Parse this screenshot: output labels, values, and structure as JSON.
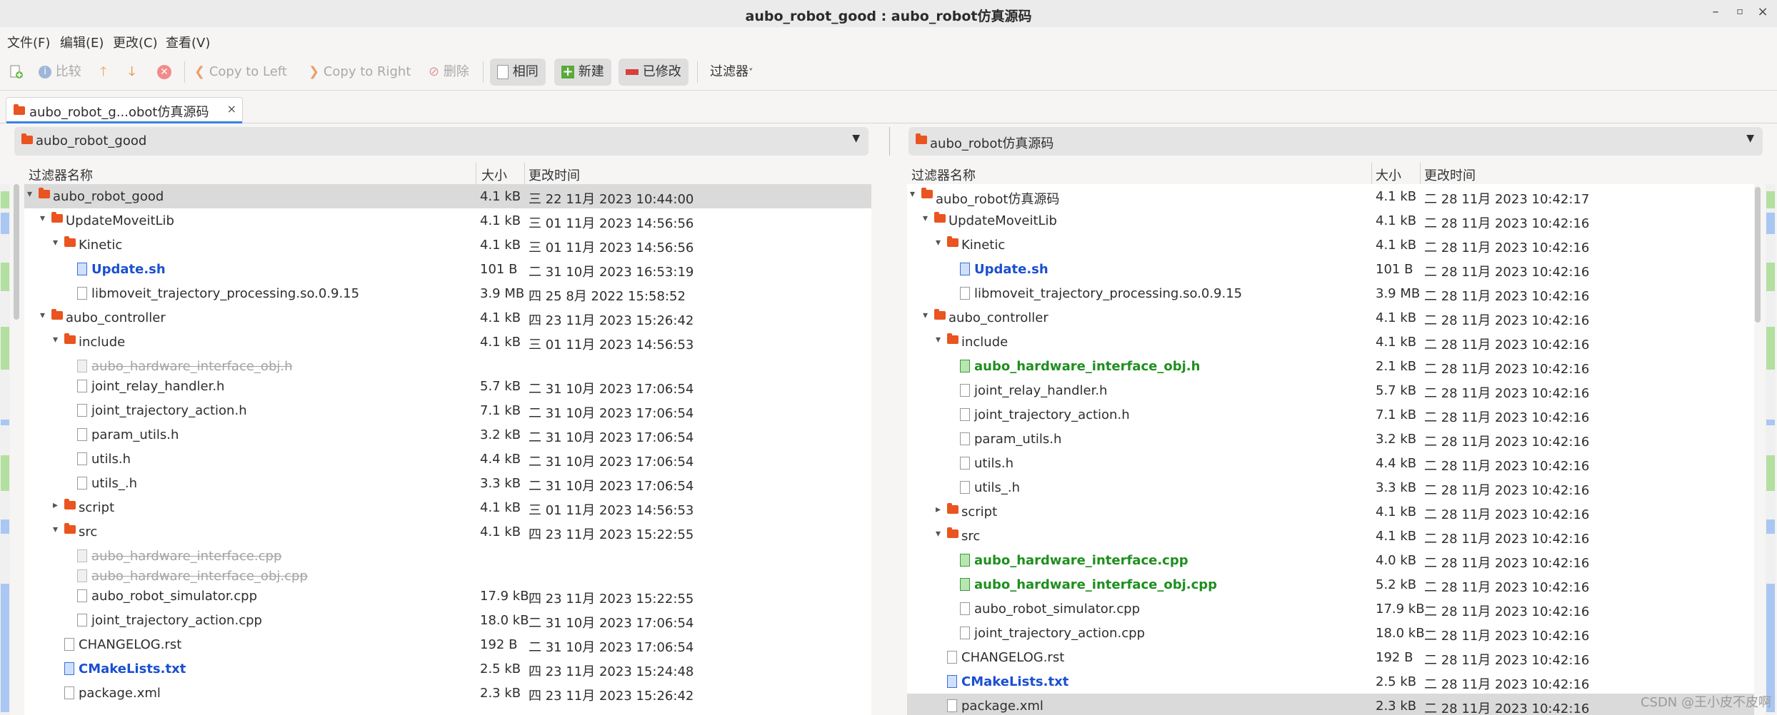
{
  "window": {
    "title": "aubo_robot_good : aubo_robot仿真源码"
  },
  "menu": [
    "文件(F)",
    "编辑(E)",
    "更改(C)",
    "查看(V)"
  ],
  "toolbar": {
    "compare": "比较",
    "copy_left": "Copy to Left",
    "copy_right": "Copy to Right",
    "delete": "删除",
    "same": "相同",
    "new": "新建",
    "modified": "已修改",
    "filter": "过滤器"
  },
  "tab": {
    "label": "aubo_robot_g...obot仿真源码"
  },
  "left": {
    "path": "aubo_robot_good",
    "columns": {
      "name": "过滤器名称",
      "size": "大小",
      "time": "更改时间"
    },
    "rows": [
      {
        "name": "aubo_robot_good",
        "size": "4.1 kB",
        "time": "三 22 11月 2023 10:44:00"
      },
      {
        "name": "UpdateMoveitLib",
        "size": "4.1 kB",
        "time": "三 01 11月 2023 14:56:56"
      },
      {
        "name": "Kinetic",
        "size": "4.1 kB",
        "time": "三 01 11月 2023 14:56:56"
      },
      {
        "name": "Update.sh",
        "size": "101 B",
        "time": "二 31 10月 2023 16:53:19"
      },
      {
        "name": "libmoveit_trajectory_processing.so.0.9.15",
        "size": "3.9 MB",
        "time": "四 25 8月 2022 15:58:52"
      },
      {
        "name": "aubo_controller",
        "size": "4.1 kB",
        "time": "四 23 11月 2023 15:26:42"
      },
      {
        "name": "include",
        "size": "4.1 kB",
        "time": "三 01 11月 2023 14:56:53"
      },
      {
        "name": "aubo_hardware_interface_obj.h",
        "size": "",
        "time": ""
      },
      {
        "name": "joint_relay_handler.h",
        "size": "5.7 kB",
        "time": "二 31 10月 2023 17:06:54"
      },
      {
        "name": "joint_trajectory_action.h",
        "size": "7.1 kB",
        "time": "二 31 10月 2023 17:06:54"
      },
      {
        "name": "param_utils.h",
        "size": "3.2 kB",
        "time": "二 31 10月 2023 17:06:54"
      },
      {
        "name": "utils.h",
        "size": "4.4 kB",
        "time": "二 31 10月 2023 17:06:54"
      },
      {
        "name": "utils_.h",
        "size": "3.3 kB",
        "time": "二 31 10月 2023 17:06:54"
      },
      {
        "name": "script",
        "size": "4.1 kB",
        "time": "三 01 11月 2023 14:56:53"
      },
      {
        "name": "src",
        "size": "4.1 kB",
        "time": "四 23 11月 2023 15:22:55"
      },
      {
        "name": "aubo_hardware_interface.cpp",
        "size": "",
        "time": ""
      },
      {
        "name": "aubo_hardware_interface_obj.cpp",
        "size": "",
        "time": ""
      },
      {
        "name": "aubo_robot_simulator.cpp",
        "size": "17.9 kB",
        "time": "四 23 11月 2023 15:22:55"
      },
      {
        "name": "joint_trajectory_action.cpp",
        "size": "18.0 kB",
        "time": "二 31 10月 2023 17:06:54"
      },
      {
        "name": "CHANGELOG.rst",
        "size": "192 B",
        "time": "二 31 10月 2023 17:06:54"
      },
      {
        "name": "CMakeLists.txt",
        "size": "2.5 kB",
        "time": "四 23 11月 2023 15:24:48"
      },
      {
        "name": "package.xml",
        "size": "2.3 kB",
        "time": "四 23 11月 2023 15:26:42"
      }
    ]
  },
  "right": {
    "path": "aubo_robot仿真源码",
    "columns": {
      "name": "过滤器名称",
      "size": "大小",
      "time": "更改时间"
    },
    "rows": [
      {
        "name": "aubo_robot仿真源码",
        "size": "4.1 kB",
        "time": "二 28 11月 2023 10:42:17"
      },
      {
        "name": "UpdateMoveitLib",
        "size": "4.1 kB",
        "time": "二 28 11月 2023 10:42:16"
      },
      {
        "name": "Kinetic",
        "size": "4.1 kB",
        "time": "二 28 11月 2023 10:42:16"
      },
      {
        "name": "Update.sh",
        "size": "101 B",
        "time": "二 28 11月 2023 10:42:16"
      },
      {
        "name": "libmoveit_trajectory_processing.so.0.9.15",
        "size": "3.9 MB",
        "time": "二 28 11月 2023 10:42:16"
      },
      {
        "name": "aubo_controller",
        "size": "4.1 kB",
        "time": "二 28 11月 2023 10:42:16"
      },
      {
        "name": "include",
        "size": "4.1 kB",
        "time": "二 28 11月 2023 10:42:16"
      },
      {
        "name": "aubo_hardware_interface_obj.h",
        "size": "2.1 kB",
        "time": "二 28 11月 2023 10:42:16"
      },
      {
        "name": "joint_relay_handler.h",
        "size": "5.7 kB",
        "time": "二 28 11月 2023 10:42:16"
      },
      {
        "name": "joint_trajectory_action.h",
        "size": "7.1 kB",
        "time": "二 28 11月 2023 10:42:16"
      },
      {
        "name": "param_utils.h",
        "size": "3.2 kB",
        "time": "二 28 11月 2023 10:42:16"
      },
      {
        "name": "utils.h",
        "size": "4.4 kB",
        "time": "二 28 11月 2023 10:42:16"
      },
      {
        "name": "utils_.h",
        "size": "3.3 kB",
        "time": "二 28 11月 2023 10:42:16"
      },
      {
        "name": "script",
        "size": "4.1 kB",
        "time": "二 28 11月 2023 10:42:16"
      },
      {
        "name": "src",
        "size": "4.1 kB",
        "time": "二 28 11月 2023 10:42:16"
      },
      {
        "name": "aubo_hardware_interface.cpp",
        "size": "4.0 kB",
        "time": "二 28 11月 2023 10:42:16"
      },
      {
        "name": "aubo_hardware_interface_obj.cpp",
        "size": "5.2 kB",
        "time": "二 28 11月 2023 10:42:16"
      },
      {
        "name": "aubo_robot_simulator.cpp",
        "size": "17.9 kB",
        "time": "二 28 11月 2023 10:42:16"
      },
      {
        "name": "joint_trajectory_action.cpp",
        "size": "18.0 kB",
        "time": "二 28 11月 2023 10:42:16"
      },
      {
        "name": "CHANGELOG.rst",
        "size": "192 B",
        "time": "二 28 11月 2023 10:42:16"
      },
      {
        "name": "CMakeLists.txt",
        "size": "2.5 kB",
        "time": "二 28 11月 2023 10:42:16"
      },
      {
        "name": "package.xml",
        "size": "2.3 kB",
        "time": "二 28 11月 2023 10:42:16"
      }
    ]
  },
  "watermark": "CSDN @王小皮不皮啊",
  "colors": {
    "new": "#1e8f1e",
    "modified": "#1a4fd0",
    "missing": "#a3a3a3",
    "accent": "#3584e4"
  }
}
